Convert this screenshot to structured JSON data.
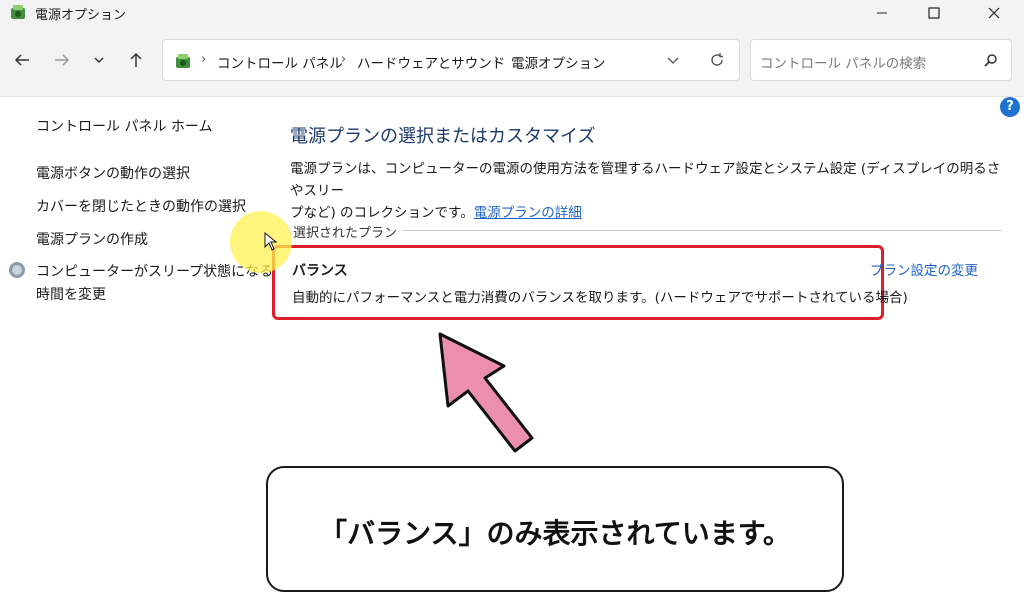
{
  "window": {
    "title": "電源オプション"
  },
  "address": {
    "crumbs": [
      "コントロール パネル",
      "ハードウェアとサウンド",
      "電源オプション"
    ]
  },
  "search": {
    "placeholder": "コントロール パネルの検索"
  },
  "sidebar": {
    "home": "コントロール パネル ホーム",
    "items": [
      "電源ボタンの動作の選択",
      "カバーを閉じたときの動作の選択",
      "電源プランの作成",
      "コンピューターがスリープ状態になる",
      "時間を変更"
    ]
  },
  "main": {
    "title": "電源プランの選択またはカスタマイズ",
    "description_line1": "電源プランは、コンピューターの電源の使用方法を管理するハードウェア設定とシステム設定 (ディスプレイの明るさやスリー",
    "description_line2": "プなど) のコレクションです。",
    "details_link": "電源プランの詳細",
    "section_label": "選択されたプラン",
    "plan": {
      "name": "バランス",
      "description": "自動的にパフォーマンスと電力消費のバランスを取ります。(ハードウェアでサポートされている場合)",
      "change_link": "プラン設定の変更"
    }
  },
  "caption": {
    "text": "「バランス」のみ表示されています。"
  },
  "colors": {
    "highlight_box": "#e01e2a",
    "arrow_fill": "#ec8fae",
    "link": "#1f63c4",
    "title": "#1c3a6b",
    "help": "#1e73d2"
  },
  "icons": {
    "app": "power-options-icon",
    "shield": "shield-icon",
    "help": "help-icon"
  }
}
